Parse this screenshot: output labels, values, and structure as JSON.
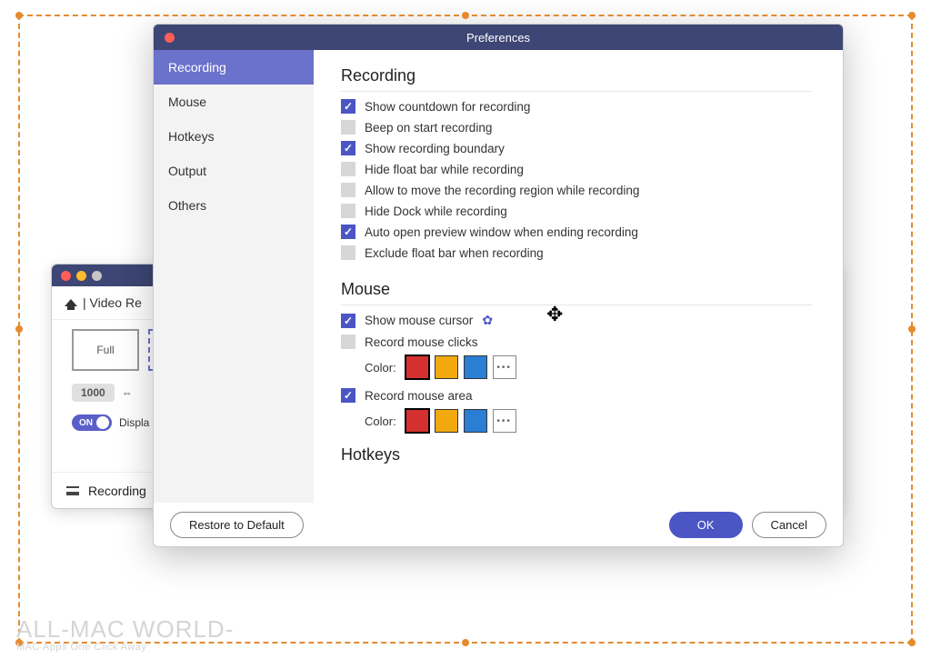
{
  "bg_window": {
    "header_label": "| Video Re",
    "mode_label": "Full",
    "size_value": "1000",
    "link_icon": "⇔",
    "toggle_on": "ON",
    "toggle_label": "Displa",
    "footer_label": "Recording"
  },
  "prefs": {
    "title": "Preferences",
    "sidebar": [
      {
        "label": "Recording",
        "active": true
      },
      {
        "label": "Mouse",
        "active": false
      },
      {
        "label": "Hotkeys",
        "active": false
      },
      {
        "label": "Output",
        "active": false
      },
      {
        "label": "Others",
        "active": false
      }
    ],
    "sections": {
      "recording": {
        "title": "Recording",
        "options": [
          {
            "label": "Show countdown for recording",
            "checked": true
          },
          {
            "label": "Beep on start recording",
            "checked": false
          },
          {
            "label": "Show recording boundary",
            "checked": true
          },
          {
            "label": "Hide float bar while recording",
            "checked": false
          },
          {
            "label": "Allow to move the recording region while recording",
            "checked": false
          },
          {
            "label": "Hide Dock while recording",
            "checked": false
          },
          {
            "label": "Auto open preview window when ending recording",
            "checked": true
          },
          {
            "label": "Exclude float bar when recording",
            "checked": false
          }
        ]
      },
      "mouse": {
        "title": "Mouse",
        "show_cursor": {
          "label": "Show mouse cursor",
          "checked": true
        },
        "record_clicks": {
          "label": "Record mouse clicks",
          "checked": false,
          "color_label": "Color:",
          "swatches": [
            "#d53030",
            "#f1a90d",
            "#2a7fd4"
          ],
          "selected": 0
        },
        "record_area": {
          "label": "Record mouse area",
          "checked": true,
          "color_label": "Color:",
          "swatches": [
            "#d53030",
            "#f1a90d",
            "#2a7fd4"
          ],
          "selected": 0
        }
      },
      "hotkeys": {
        "title": "Hotkeys"
      }
    },
    "footer": {
      "restore": "Restore to Default",
      "ok": "OK",
      "cancel": "Cancel"
    }
  },
  "watermark": {
    "line1": "ALL-MAC  WORLD-",
    "line2": "MAC Apps One Click Away"
  },
  "more_glyph": "•••"
}
